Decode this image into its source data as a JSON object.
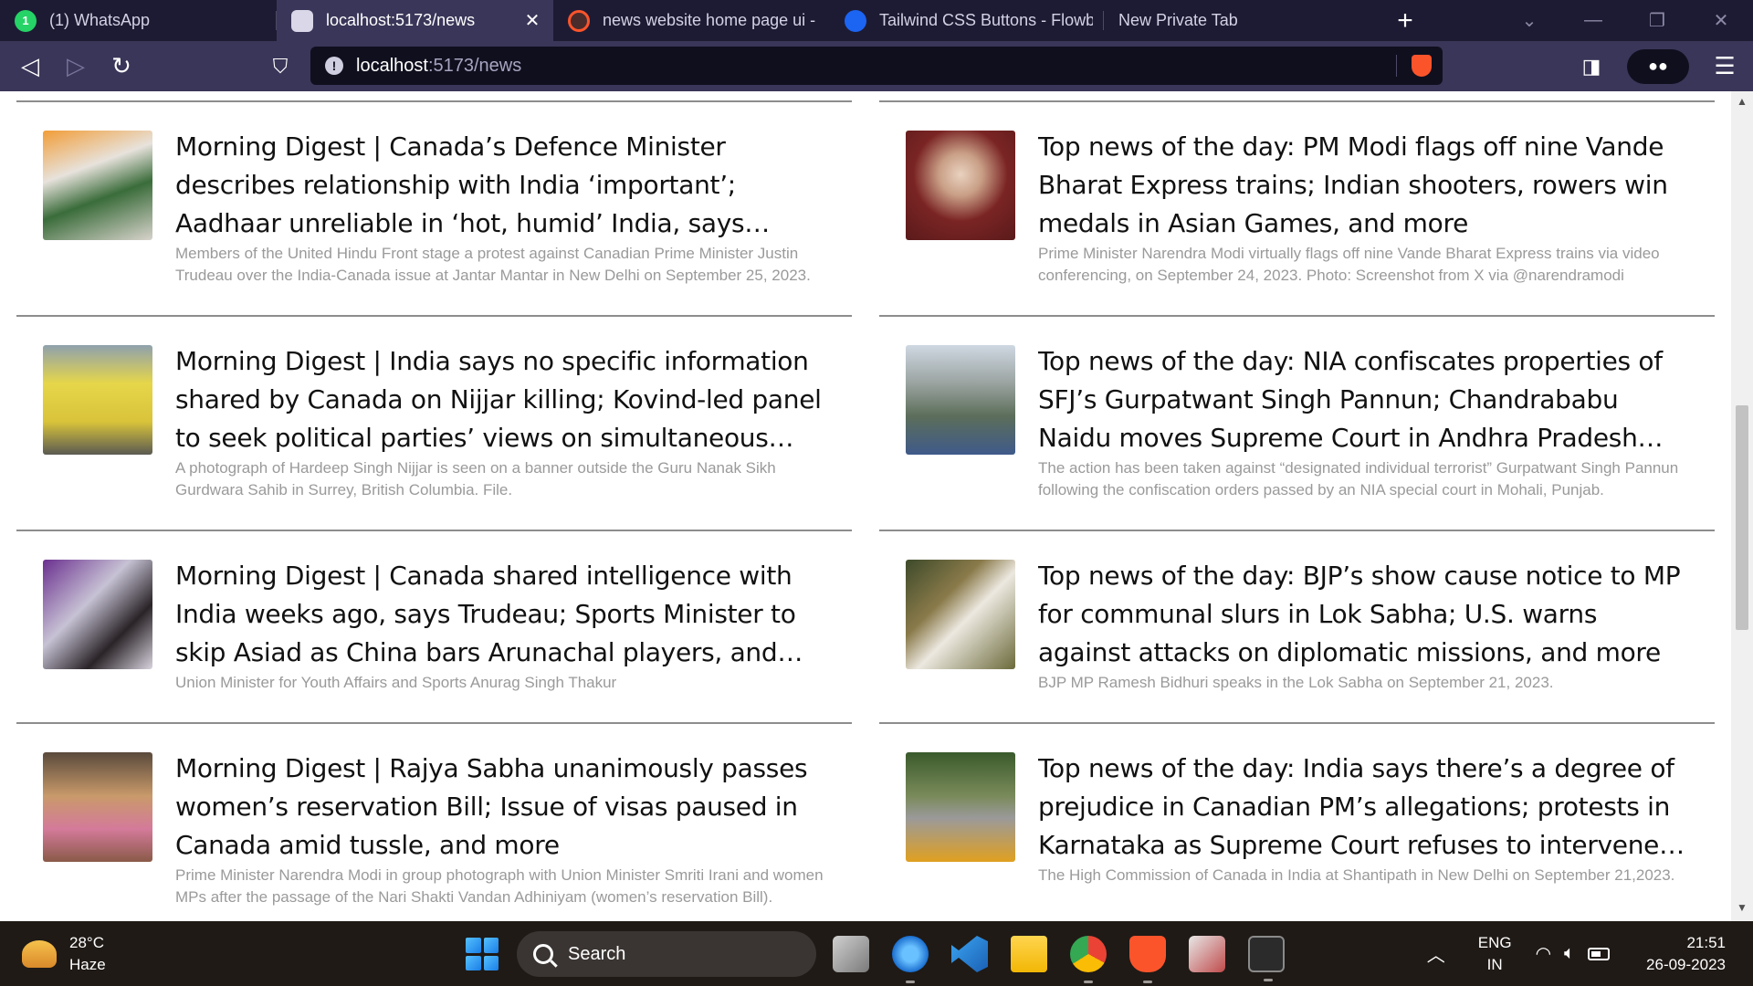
{
  "browser": {
    "tabs": [
      {
        "title": "(1) WhatsApp",
        "favicon": "whatsapp-icon",
        "active": false
      },
      {
        "title": "localhost:5173/news",
        "favicon": "page-icon",
        "active": true
      },
      {
        "title": "news website home page ui - B",
        "favicon": "brave-search-icon",
        "active": false
      },
      {
        "title": "Tailwind CSS Buttons - Flowbite",
        "favicon": "flowbite-icon",
        "active": false
      },
      {
        "title": "New Private Tab",
        "favicon": "",
        "active": false
      }
    ],
    "url_host": "localhost",
    "url_path": ":5173/news"
  },
  "articles": {
    "left": [
      {
        "title": "Morning Digest | Canada’s Defence Minister describes relationship with India ‘important’; Aadhaar unreliable in ‘hot, humid’ India, says Moody’s, and more",
        "caption": "Members of the United Hindu Front stage a protest against Canadian Prime Minister Justin Trudeau over the India-Canada issue at Jantar Mantar in New Delhi on September 25, 2023."
      },
      {
        "title": "Morning Digest | India says no specific information shared by Canada on Nijjar killing; Kovind-led panel to seek political parties’ views on simultaneous polls, and more",
        "caption": "A photograph of Hardeep Singh Nijjar is seen on a banner outside the Guru Nanak Sikh Gurdwara Sahib in Surrey, British Columbia. File."
      },
      {
        "title": "Morning Digest | Canada shared intelligence with India weeks ago, says Trudeau; Sports Minister to skip Asiad as China bars Arunachal players, and more",
        "caption": "Union Minister for Youth Affairs and Sports Anurag Singh Thakur"
      },
      {
        "title": "Morning Digest | Rajya Sabha unanimously passes women’s reservation Bill; Issue of visas paused in Canada amid tussle, and more",
        "caption": "Prime Minister Narendra Modi in group photograph with Union Minister Smriti Irani and women MPs after the passage of the Nari Shakti Vandan Adhiniyam (women’s reservation Bill)."
      }
    ],
    "right": [
      {
        "title": "Top news of the day: PM Modi flags off nine Vande Bharat Express trains; Indian shooters, rowers win medals in Asian Games, and more",
        "caption": "Prime Minister Narendra Modi virtually flags off nine Vande Bharat Express trains via video conferencing, on September 24, 2023. Photo: Screenshot from X via @narendramodi"
      },
      {
        "title": "Top news of the day: NIA confiscates properties of SFJ’s Gurpatwant Singh Pannun; Chandrababu Naidu moves Supreme Court in Andhra Pradesh skill development case, and more",
        "caption": "The action has been taken against “designated individual terrorist” Gurpatwant Singh Pannun following the confiscation orders passed by an NIA special court in Mohali, Punjab."
      },
      {
        "title": "Top news of the day: BJP’s show cause notice to MP for communal slurs in Lok Sabha; U.S. warns against attacks on diplomatic missions, and more",
        "caption": "BJP MP Ramesh Bidhuri speaks in the Lok Sabha on September 21, 2023."
      },
      {
        "title": "Top news of the day: India says there’s a degree of prejudice in Canadian PM’s allegations; protests in Karnataka as Supreme Court refuses to intervene in Cauvery row, and more",
        "caption": "The High Commission of Canada in India at Shantipath in New Delhi on September 21,2023."
      }
    ]
  },
  "taskbar": {
    "weather_temp": "28°C",
    "weather_desc": "Haze",
    "search_label": "Search",
    "lang_line1": "ENG",
    "lang_line2": "IN",
    "time": "21:51",
    "date": "26-09-2023"
  }
}
